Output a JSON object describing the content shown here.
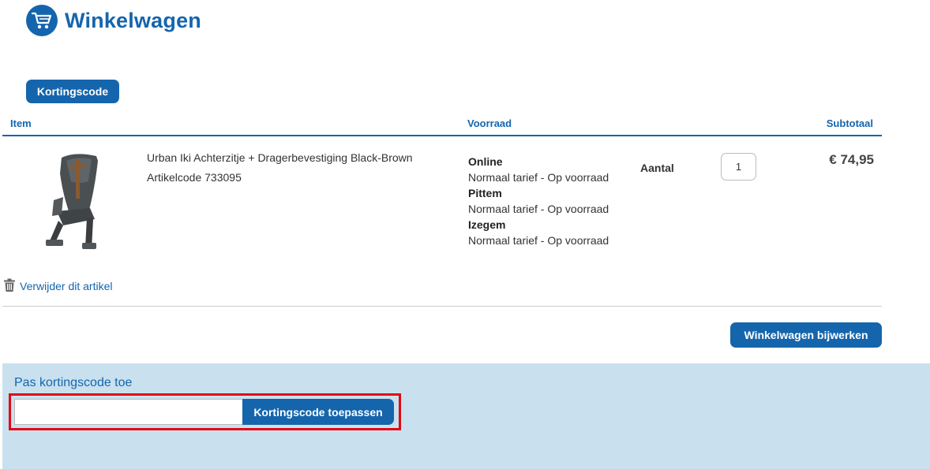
{
  "header": {
    "title": "Winkelwagen",
    "icon": "shopping-cart-icon"
  },
  "discount_button_label": "Kortingscode",
  "table": {
    "headers": {
      "item": "Item",
      "stock": "Voorraad",
      "subtotal": "Subtotaal"
    }
  },
  "item": {
    "name": "Urban Iki Achterzitje + Dragerbevestiging Black-Brown",
    "sku": "Artikelcode 733095",
    "stock": [
      {
        "location": "Online",
        "status": "Normaal tarief - Op voorraad"
      },
      {
        "location": "Pittem",
        "status": "Normaal tarief - Op voorraad"
      },
      {
        "location": "Izegem",
        "status": "Normaal tarief - Op voorraad"
      }
    ],
    "quantity_label": "Aantal",
    "quantity": "1",
    "price": "€ 74,95",
    "remove_label": "Verwijder dit artikel"
  },
  "update_button_label": "Winkelwagen bijwerken",
  "coupon": {
    "title": "Pas kortingscode toe",
    "input_value": "",
    "apply_label": "Kortingscode toepassen"
  },
  "colors": {
    "brand": "#1565ad",
    "panel": "#c9e1ef",
    "highlight": "#e30613"
  }
}
